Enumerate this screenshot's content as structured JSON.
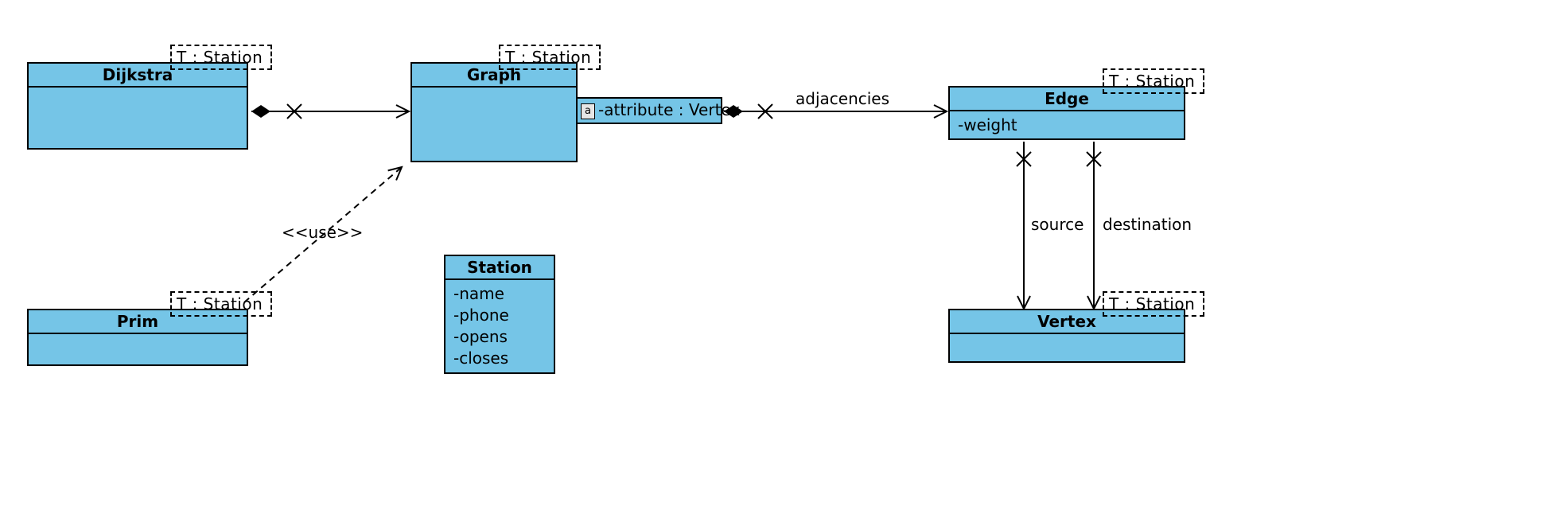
{
  "classes": {
    "dijkstra": {
      "name": "Dijkstra",
      "template": "T : Station"
    },
    "graph": {
      "name": "Graph",
      "template": "T : Station",
      "nested_attr": "-attribute : Vertex",
      "nested_marker": "a"
    },
    "prim": {
      "name": "Prim",
      "template": "T : Station"
    },
    "station": {
      "name": "Station",
      "attrs": [
        "-name",
        "-phone",
        "-opens",
        "-closes"
      ]
    },
    "edge": {
      "name": "Edge",
      "template": "T : Station",
      "attrs": [
        "-weight"
      ]
    },
    "vertex": {
      "name": "Vertex",
      "template": "T : Station"
    }
  },
  "relations": {
    "use_label": "<<use>>",
    "adjacencies": "adjacencies",
    "source": "source",
    "destination": "destination"
  }
}
